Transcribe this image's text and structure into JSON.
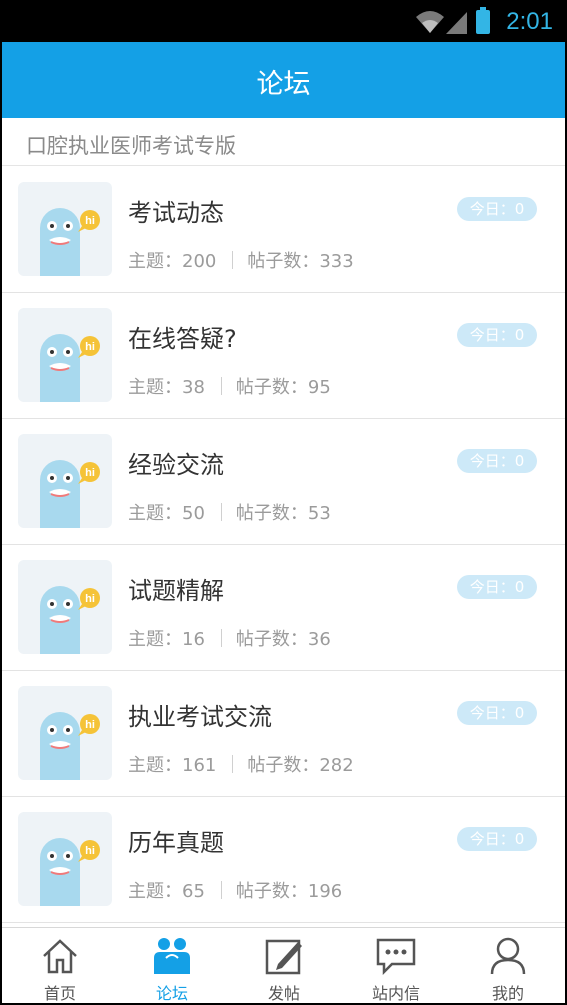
{
  "status_bar": {
    "time": "2:01"
  },
  "nav": {
    "title": "论坛"
  },
  "section": {
    "title": "口腔执业医师考试专版"
  },
  "forums": [
    {
      "name": "考试动态",
      "topics": "主题：200",
      "posts": "帖子数：333",
      "today": "今日：0"
    },
    {
      "name": "在线答疑?",
      "topics": "主题：38",
      "posts": "帖子数：95",
      "today": "今日：0"
    },
    {
      "name": "经验交流",
      "topics": "主题：50",
      "posts": "帖子数：53",
      "today": "今日：0"
    },
    {
      "name": "试题精解",
      "topics": "主题：16",
      "posts": "帖子数：36",
      "today": "今日：0"
    },
    {
      "name": "执业考试交流",
      "topics": "主题：161",
      "posts": "帖子数：282",
      "today": "今日：0"
    },
    {
      "name": "历年真题",
      "topics": "主题：65",
      "posts": "帖子数：196",
      "today": "今日：0"
    }
  ],
  "tabs": [
    {
      "label": "首页",
      "icon": "home-icon",
      "active": false
    },
    {
      "label": "论坛",
      "icon": "forum-icon",
      "active": true
    },
    {
      "label": "发帖",
      "icon": "compose-icon",
      "active": false
    },
    {
      "label": "站内信",
      "icon": "message-icon",
      "active": false
    },
    {
      "label": "我的",
      "icon": "profile-icon",
      "active": false
    }
  ],
  "colors": {
    "primary": "#14a0e6",
    "badge": "#cde9f8",
    "mascot": "#a8d9ee",
    "bubble": "#f5c338"
  }
}
